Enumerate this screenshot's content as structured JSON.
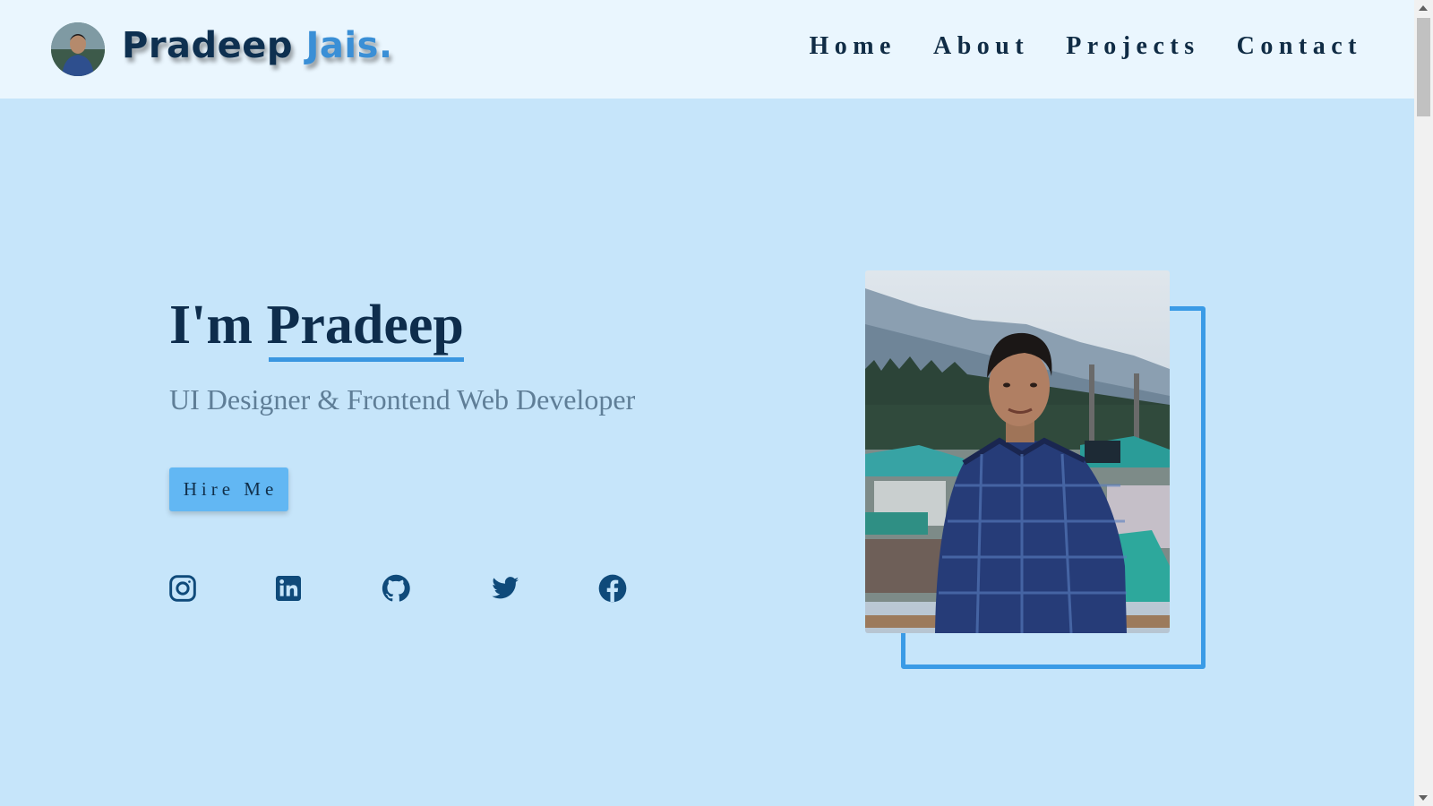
{
  "header": {
    "logo_first": "Pradeep",
    "logo_second": "Jais",
    "logo_dot": ".",
    "nav": [
      "Home",
      "About",
      "Projects",
      "Contact"
    ]
  },
  "hero": {
    "title_prefix": "I'm",
    "title_name": "Pradeep",
    "subtitle": "UI Designer & Frontend Web Developer",
    "cta_label": "Hire Me"
  },
  "socials": [
    {
      "icon": "instagram-icon"
    },
    {
      "icon": "linkedin-icon"
    },
    {
      "icon": "github-icon"
    },
    {
      "icon": "twitter-icon"
    },
    {
      "icon": "facebook-icon"
    }
  ],
  "colors": {
    "background": "#c6e5fa",
    "header_background": "#eaf6fe",
    "accent": "#3a96e0",
    "button": "#62b7f3",
    "text_dark": "#0e2d4c",
    "text_muted": "#5f7e97"
  }
}
